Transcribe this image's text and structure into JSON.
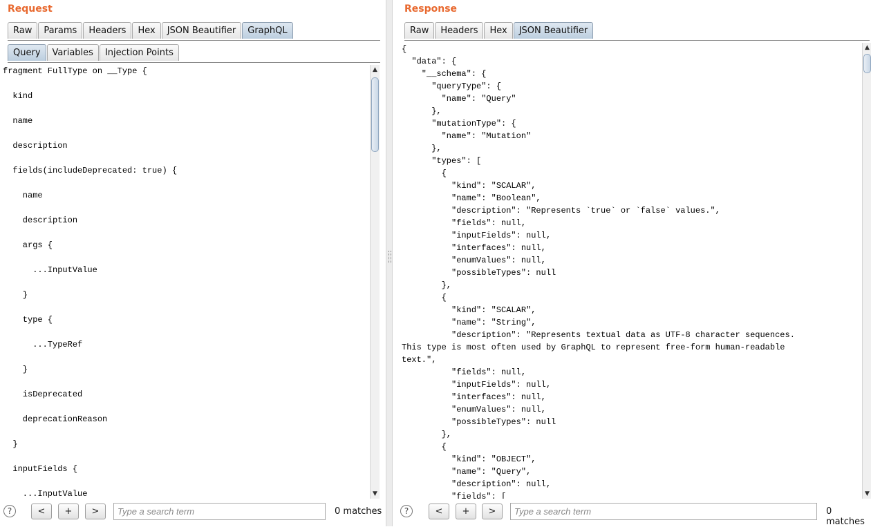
{
  "request": {
    "title": "Request",
    "tabs": [
      "Raw",
      "Params",
      "Headers",
      "Hex",
      "JSON Beautifier",
      "GraphQL"
    ],
    "active_tab": "GraphQL",
    "subtabs": [
      "Query",
      "Variables",
      "Injection Points"
    ],
    "active_subtab": "Query",
    "code": "fragment FullType on __Type {\n\n  kind\n\n  name\n\n  description\n\n  fields(includeDeprecated: true) {\n\n    name\n\n    description\n\n    args {\n\n      ...InputValue\n\n    }\n\n    type {\n\n      ...TypeRef\n\n    }\n\n    isDeprecated\n\n    deprecationReason\n\n  }\n\n  inputFields {\n\n    ...InputValue",
    "search": {
      "help": "?",
      "prev": "<",
      "add": "+",
      "next": ">",
      "placeholder": "Type a search term",
      "matches": "0 matches"
    }
  },
  "response": {
    "title": "Response",
    "tabs": [
      "Raw",
      "Headers",
      "Hex",
      "JSON Beautifier"
    ],
    "active_tab": "JSON Beautifier",
    "code": "{\n  \"data\": {\n    \"__schema\": {\n      \"queryType\": {\n        \"name\": \"Query\"\n      },\n      \"mutationType\": {\n        \"name\": \"Mutation\"\n      },\n      \"types\": [\n        {\n          \"kind\": \"SCALAR\",\n          \"name\": \"Boolean\",\n          \"description\": \"Represents `true` or `false` values.\",\n          \"fields\": null,\n          \"inputFields\": null,\n          \"interfaces\": null,\n          \"enumValues\": null,\n          \"possibleTypes\": null\n        },\n        {\n          \"kind\": \"SCALAR\",\n          \"name\": \"String\",\n          \"description\": \"Represents textual data as UTF-8 character sequences.\nThis type is most often used by GraphQL to represent free-form human-readable\ntext.\",\n          \"fields\": null,\n          \"inputFields\": null,\n          \"interfaces\": null,\n          \"enumValues\": null,\n          \"possibleTypes\": null\n        },\n        {\n          \"kind\": \"OBJECT\",\n          \"name\": \"Query\",\n          \"description\": null,\n          \"fields\": [",
    "search": {
      "help": "?",
      "prev": "<",
      "add": "+",
      "next": ">",
      "placeholder": "Type a search term",
      "matches": "0 matches"
    }
  },
  "icons": {
    "scroll_up": "up-arrow-icon",
    "scroll_down": "down-arrow-icon",
    "help": "help-icon"
  },
  "colors": {
    "title": "#e8682e",
    "active_tab": "#bccedf"
  }
}
